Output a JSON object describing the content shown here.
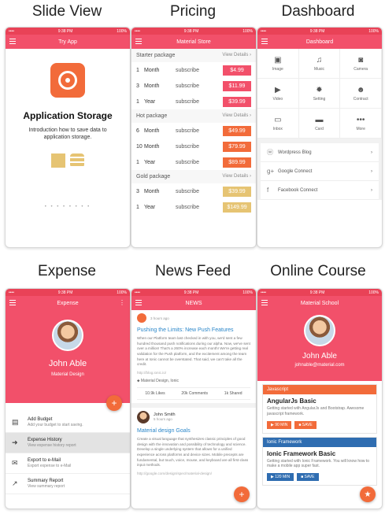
{
  "captions": [
    "Slide View",
    "Pricing",
    "Dashboard",
    "Expense",
    "News Feed",
    "Online Course"
  ],
  "colors": {
    "primary": "#f2506a",
    "orange": "#f26b3a",
    "gold": "#e6c473",
    "blue": "#2a86c9",
    "navy": "#2f6db1"
  },
  "status_bar": {
    "time": "9:38 PM",
    "carrier": "•••• ",
    "battery": "100%"
  },
  "slide": {
    "appbar_title": "Try App",
    "title": "Application Storage",
    "description": "Introduction how to save data to application storage.",
    "pager": "• • • • • • • •"
  },
  "pricing": {
    "appbar_title": "Material Store",
    "view_details": "View Details ›",
    "packages": [
      {
        "name": "Starter package",
        "color": "#f2506a",
        "rows": [
          {
            "qty": "1",
            "unit": "Month",
            "label": "subscribe",
            "price": "$4.99"
          },
          {
            "qty": "3",
            "unit": "Month",
            "label": "subscribe",
            "price": "$11.99"
          },
          {
            "qty": "1",
            "unit": "Year",
            "label": "subscribe",
            "price": "$39.99"
          }
        ]
      },
      {
        "name": "Hot package",
        "color": "#f26b3a",
        "rows": [
          {
            "qty": "6",
            "unit": "Month",
            "label": "subscribe",
            "price": "$49.99"
          },
          {
            "qty": "10",
            "unit": "Month",
            "label": "subscribe",
            "price": "$79.99"
          },
          {
            "qty": "1",
            "unit": "Year",
            "label": "subscribe",
            "price": "$89.99"
          }
        ]
      },
      {
        "name": "Gold package",
        "color": "#e6c473",
        "rows": [
          {
            "qty": "3",
            "unit": "Month",
            "label": "subscribe",
            "price": "$39.99"
          },
          {
            "qty": "1",
            "unit": "Year",
            "label": "subscribe",
            "price": "$149.99"
          }
        ]
      }
    ]
  },
  "dashboard": {
    "appbar_title": "Dashboard",
    "tiles": [
      {
        "label": "Image",
        "icon": "image-icon",
        "glyph": "▣"
      },
      {
        "label": "Music",
        "icon": "music-icon",
        "glyph": "♫"
      },
      {
        "label": "Camera",
        "icon": "camera-icon",
        "glyph": "◙"
      },
      {
        "label": "Video",
        "icon": "video-icon",
        "glyph": "▶"
      },
      {
        "label": "Setting",
        "icon": "gear-icon",
        "glyph": "✹"
      },
      {
        "label": "Contract",
        "icon": "people-icon",
        "glyph": "☻"
      },
      {
        "label": "Inbox",
        "icon": "inbox-icon",
        "glyph": "▭"
      },
      {
        "label": "Card",
        "icon": "card-icon",
        "glyph": "▬"
      },
      {
        "label": "More",
        "icon": "more-icon",
        "glyph": "•••"
      }
    ],
    "links": [
      {
        "label": "Wordpress Blog",
        "icon": "wordpress-icon",
        "glyph": "ⓦ"
      },
      {
        "label": "Google Connect",
        "icon": "google-plus-icon",
        "glyph": "g+"
      },
      {
        "label": "Facebook Connect",
        "icon": "facebook-icon",
        "glyph": "f"
      }
    ],
    "chevron": "›"
  },
  "expense": {
    "appbar_title": "Expense",
    "name": "John Able",
    "subtitle": "Material Design",
    "fab": "+",
    "items": [
      {
        "title": "Add Budget",
        "sub": "Add your budget to start saving.",
        "glyph": "▤",
        "icon": "budget-icon"
      },
      {
        "title": "Expense History",
        "sub": "View expense history report",
        "glyph": "➜",
        "icon": "history-icon"
      },
      {
        "title": "Export to e-Mail",
        "sub": "Export expense to e-Mail",
        "glyph": "✉",
        "icon": "mail-icon"
      },
      {
        "title": "Summary Report",
        "sub": "View summary report",
        "glyph": "↗",
        "icon": "report-icon"
      }
    ]
  },
  "news": {
    "appbar_title": "NEWS",
    "post1": {
      "time": "3 hours ago",
      "title": "Pushing the Limits: New Push Features",
      "body": "When our Platform team last checked in with you, we'd sent a few hundred thousand push notifications during our alpha. Now, we've sent over a million! That's a 260% increase each month! We're getting real validation for the Push platform, and the excitement among the team here at Ionic cannot be overstated. That said, we can't take all the credit.",
      "link": "http://blog.ionic.io/",
      "tags": "Material Design, Ionic",
      "stats": [
        "10.9k Likes",
        "20k Comments",
        "1k Shared"
      ]
    },
    "post2": {
      "author": "John Smith",
      "time": "5 hours ago",
      "title": "Material design Goals",
      "body": "Create a visual language that synthesizes classic principles of good design with the innovation and possibility of technology and science. Develop a single underlying system that allows for a unified experience across platforms and device sizes. Mobile precepts are fundamental, but touch, voice, mouse, and keyboard are all first-class input methods.",
      "link": "http://google.com/design/spec/material-design/"
    },
    "fab": "+"
  },
  "course": {
    "appbar_title": "Material School",
    "name": "John Able",
    "email": "johnable@material.com",
    "sections": [
      {
        "label": "Javascript",
        "color": "#f26b3a",
        "title": "AngularJs Basic",
        "desc": "Getting started with AngularJs and Bootstrap. Awesome javascript framework.",
        "min": "▶ 90 MIN",
        "save": "■ SAVE"
      },
      {
        "label": "Ionic Framework",
        "color": "#2f6db1",
        "title": "Ionic Framework Basic",
        "desc": "Getting started with Ionic Framework. You will know how to make a mobile app super fast.",
        "min": "▶ 120 MIN",
        "save": "■ SAVE"
      }
    ],
    "fab": "★"
  }
}
